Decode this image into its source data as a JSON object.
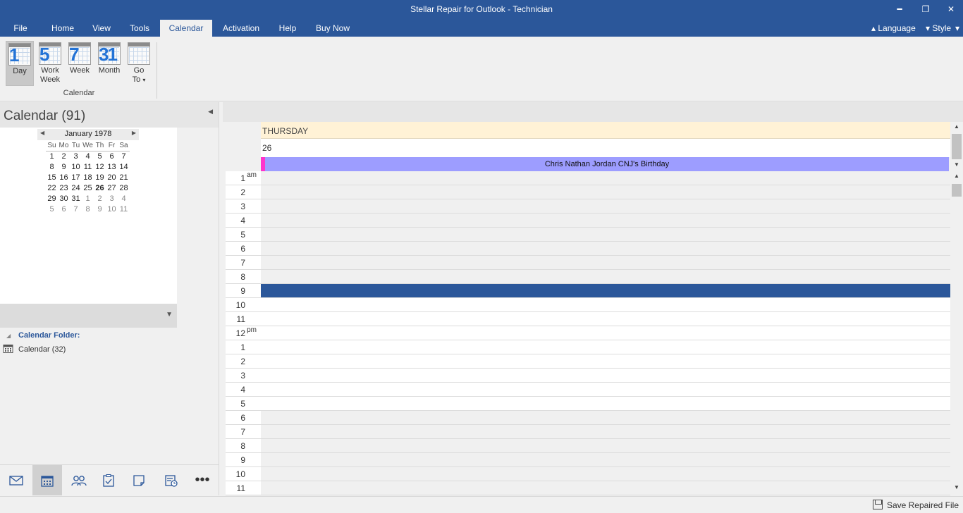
{
  "window": {
    "title": "Stellar Repair for Outlook - Technician",
    "minimize": "━",
    "restore": "❐",
    "close": "✕"
  },
  "menu": {
    "tabs": [
      "File",
      "Home",
      "View",
      "Tools",
      "Calendar",
      "Activation",
      "Help",
      "Buy Now"
    ],
    "active": "Calendar",
    "language": "Language",
    "style": "Style"
  },
  "ribbon": {
    "buttons": [
      {
        "num": "1",
        "label": "Day",
        "selected": true
      },
      {
        "num": "5",
        "label": "Work Week"
      },
      {
        "num": "7",
        "label": "Week"
      },
      {
        "num": "31",
        "label": "Month"
      },
      {
        "num": "",
        "label": "Go To"
      }
    ],
    "group_label": "Calendar"
  },
  "left_pane": {
    "title": "Calendar (91)",
    "mini_calendar": {
      "month": "January 1978",
      "weekdays": [
        "Su",
        "Mo",
        "Tu",
        "We",
        "Th",
        "Fr",
        "Sa"
      ],
      "weeks": [
        [
          "1",
          "2",
          "3",
          "4",
          "5",
          "6",
          "7"
        ],
        [
          "8",
          "9",
          "10",
          "11",
          "12",
          "13",
          "14"
        ],
        [
          "15",
          "16",
          "17",
          "18",
          "19",
          "20",
          "21"
        ],
        [
          "22",
          "23",
          "24",
          "25",
          "26",
          "27",
          "28"
        ],
        [
          "29",
          "30",
          "31",
          "1",
          "2",
          "3",
          "4"
        ],
        [
          "5",
          "6",
          "7",
          "8",
          "9",
          "10",
          "11"
        ]
      ],
      "today": "26"
    },
    "folder_header": "Calendar Folder:",
    "folder_item": "Calendar (32)"
  },
  "nav_icons": [
    "mail-icon",
    "calendar-icon",
    "contacts-icon",
    "tasks-icon",
    "notes-icon",
    "journal-icon",
    "more-icon"
  ],
  "day_view": {
    "day_name": "THURSDAY",
    "date": "26",
    "all_day_event": "Chris Nathan Jordan CNJ's Birthday",
    "hours": [
      {
        "h": "1",
        "ampm": "am"
      },
      {
        "h": "2"
      },
      {
        "h": "3"
      },
      {
        "h": "4"
      },
      {
        "h": "5"
      },
      {
        "h": "6"
      },
      {
        "h": "7"
      },
      {
        "h": "8"
      },
      {
        "h": "9"
      },
      {
        "h": "10"
      },
      {
        "h": "11"
      },
      {
        "h": "12",
        "ampm": "pm"
      },
      {
        "h": "1"
      },
      {
        "h": "2"
      },
      {
        "h": "3"
      },
      {
        "h": "4"
      },
      {
        "h": "5"
      },
      {
        "h": "6"
      },
      {
        "h": "7"
      },
      {
        "h": "8"
      },
      {
        "h": "9"
      },
      {
        "h": "10"
      },
      {
        "h": "11"
      }
    ],
    "selected_hour_index": 8,
    "work_hours_range": [
      8,
      16
    ]
  },
  "status": {
    "save_label": "Save Repaired File"
  },
  "colors": {
    "brand": "#2b579a",
    "event": "#9d9dff",
    "event_marker": "#ff33cc"
  }
}
